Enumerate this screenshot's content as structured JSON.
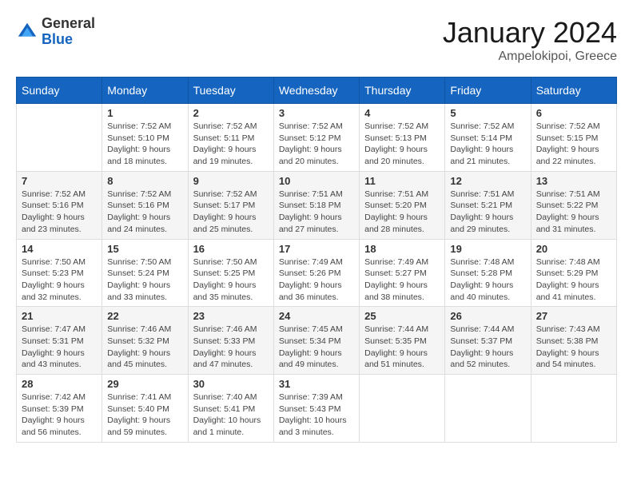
{
  "logo": {
    "general": "General",
    "blue": "Blue"
  },
  "title": "January 2024",
  "subtitle": "Ampelokipoi, Greece",
  "columns": [
    "Sunday",
    "Monday",
    "Tuesday",
    "Wednesday",
    "Thursday",
    "Friday",
    "Saturday"
  ],
  "weeks": [
    [
      {
        "day": "",
        "info": ""
      },
      {
        "day": "1",
        "info": "Sunrise: 7:52 AM\nSunset: 5:10 PM\nDaylight: 9 hours\nand 18 minutes."
      },
      {
        "day": "2",
        "info": "Sunrise: 7:52 AM\nSunset: 5:11 PM\nDaylight: 9 hours\nand 19 minutes."
      },
      {
        "day": "3",
        "info": "Sunrise: 7:52 AM\nSunset: 5:12 PM\nDaylight: 9 hours\nand 20 minutes."
      },
      {
        "day": "4",
        "info": "Sunrise: 7:52 AM\nSunset: 5:13 PM\nDaylight: 9 hours\nand 20 minutes."
      },
      {
        "day": "5",
        "info": "Sunrise: 7:52 AM\nSunset: 5:14 PM\nDaylight: 9 hours\nand 21 minutes."
      },
      {
        "day": "6",
        "info": "Sunrise: 7:52 AM\nSunset: 5:15 PM\nDaylight: 9 hours\nand 22 minutes."
      }
    ],
    [
      {
        "day": "7",
        "info": "Sunrise: 7:52 AM\nSunset: 5:16 PM\nDaylight: 9 hours\nand 23 minutes."
      },
      {
        "day": "8",
        "info": "Sunrise: 7:52 AM\nSunset: 5:16 PM\nDaylight: 9 hours\nand 24 minutes."
      },
      {
        "day": "9",
        "info": "Sunrise: 7:52 AM\nSunset: 5:17 PM\nDaylight: 9 hours\nand 25 minutes."
      },
      {
        "day": "10",
        "info": "Sunrise: 7:51 AM\nSunset: 5:18 PM\nDaylight: 9 hours\nand 27 minutes."
      },
      {
        "day": "11",
        "info": "Sunrise: 7:51 AM\nSunset: 5:20 PM\nDaylight: 9 hours\nand 28 minutes."
      },
      {
        "day": "12",
        "info": "Sunrise: 7:51 AM\nSunset: 5:21 PM\nDaylight: 9 hours\nand 29 minutes."
      },
      {
        "day": "13",
        "info": "Sunrise: 7:51 AM\nSunset: 5:22 PM\nDaylight: 9 hours\nand 31 minutes."
      }
    ],
    [
      {
        "day": "14",
        "info": "Sunrise: 7:50 AM\nSunset: 5:23 PM\nDaylight: 9 hours\nand 32 minutes."
      },
      {
        "day": "15",
        "info": "Sunrise: 7:50 AM\nSunset: 5:24 PM\nDaylight: 9 hours\nand 33 minutes."
      },
      {
        "day": "16",
        "info": "Sunrise: 7:50 AM\nSunset: 5:25 PM\nDaylight: 9 hours\nand 35 minutes."
      },
      {
        "day": "17",
        "info": "Sunrise: 7:49 AM\nSunset: 5:26 PM\nDaylight: 9 hours\nand 36 minutes."
      },
      {
        "day": "18",
        "info": "Sunrise: 7:49 AM\nSunset: 5:27 PM\nDaylight: 9 hours\nand 38 minutes."
      },
      {
        "day": "19",
        "info": "Sunrise: 7:48 AM\nSunset: 5:28 PM\nDaylight: 9 hours\nand 40 minutes."
      },
      {
        "day": "20",
        "info": "Sunrise: 7:48 AM\nSunset: 5:29 PM\nDaylight: 9 hours\nand 41 minutes."
      }
    ],
    [
      {
        "day": "21",
        "info": "Sunrise: 7:47 AM\nSunset: 5:31 PM\nDaylight: 9 hours\nand 43 minutes."
      },
      {
        "day": "22",
        "info": "Sunrise: 7:46 AM\nSunset: 5:32 PM\nDaylight: 9 hours\nand 45 minutes."
      },
      {
        "day": "23",
        "info": "Sunrise: 7:46 AM\nSunset: 5:33 PM\nDaylight: 9 hours\nand 47 minutes."
      },
      {
        "day": "24",
        "info": "Sunrise: 7:45 AM\nSunset: 5:34 PM\nDaylight: 9 hours\nand 49 minutes."
      },
      {
        "day": "25",
        "info": "Sunrise: 7:44 AM\nSunset: 5:35 PM\nDaylight: 9 hours\nand 51 minutes."
      },
      {
        "day": "26",
        "info": "Sunrise: 7:44 AM\nSunset: 5:37 PM\nDaylight: 9 hours\nand 52 minutes."
      },
      {
        "day": "27",
        "info": "Sunrise: 7:43 AM\nSunset: 5:38 PM\nDaylight: 9 hours\nand 54 minutes."
      }
    ],
    [
      {
        "day": "28",
        "info": "Sunrise: 7:42 AM\nSunset: 5:39 PM\nDaylight: 9 hours\nand 56 minutes."
      },
      {
        "day": "29",
        "info": "Sunrise: 7:41 AM\nSunset: 5:40 PM\nDaylight: 9 hours\nand 59 minutes."
      },
      {
        "day": "30",
        "info": "Sunrise: 7:40 AM\nSunset: 5:41 PM\nDaylight: 10 hours\nand 1 minute."
      },
      {
        "day": "31",
        "info": "Sunrise: 7:39 AM\nSunset: 5:43 PM\nDaylight: 10 hours\nand 3 minutes."
      },
      {
        "day": "",
        "info": ""
      },
      {
        "day": "",
        "info": ""
      },
      {
        "day": "",
        "info": ""
      }
    ]
  ]
}
